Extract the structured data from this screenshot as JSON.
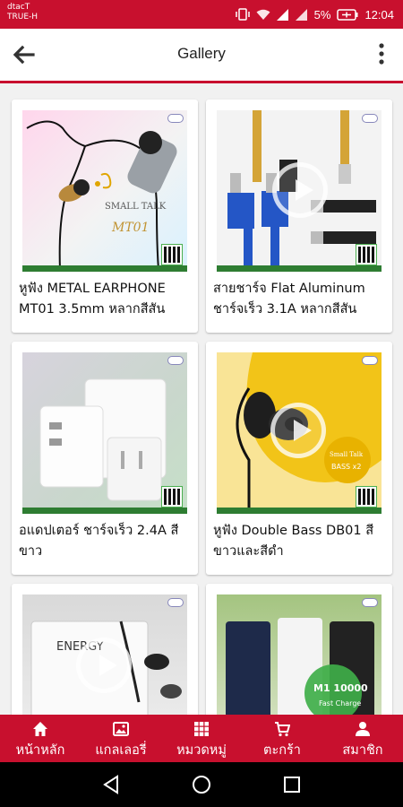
{
  "status_bar": {
    "carrier_line1": "dtacT",
    "carrier_line2": "TRUE-H",
    "battery_percent": "5%",
    "time": "12:04"
  },
  "app_bar": {
    "title": "Gallery",
    "back_icon": "arrow-left-icon",
    "menu_icon": "more-vertical-icon"
  },
  "gallery": {
    "items": [
      {
        "caption": "หูฟัง METAL EARPHONE MT01 3.5mm หลากสีสัน",
        "has_video": false
      },
      {
        "caption": "สายชาร์จ Flat Aluminum ชาร์จเร็ว 3.1A หลากสีสัน",
        "has_video": true
      },
      {
        "caption": "อแดปเตอร์ ชาร์จเร็ว 2.4A สีขาว",
        "has_video": false
      },
      {
        "caption": "หูฟัง Double Bass DB01 สีขาวและสีดำ",
        "has_video": true
      },
      {
        "caption": "",
        "has_video": true
      },
      {
        "caption": "",
        "has_video": false
      }
    ]
  },
  "bottom_nav": {
    "items": [
      {
        "label": "หน้าหลัก",
        "icon": "home-icon"
      },
      {
        "label": "แกลเลอรี่",
        "icon": "gallery-icon"
      },
      {
        "label": "หมวดหมู่",
        "icon": "grid-icon"
      },
      {
        "label": "ตะกร้า",
        "icon": "cart-icon"
      },
      {
        "label": "สมาชิก",
        "icon": "user-icon"
      }
    ]
  },
  "colors": {
    "primary": "#c8102e",
    "background": "#f1f1f1",
    "card": "#ffffff"
  }
}
